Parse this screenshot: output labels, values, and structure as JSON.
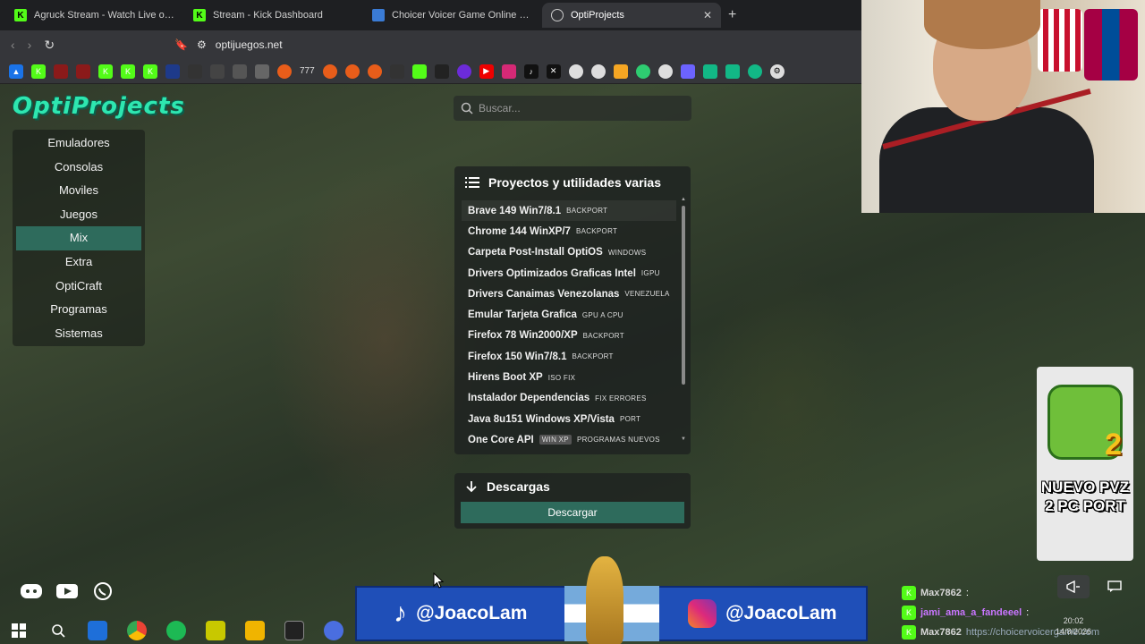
{
  "browser": {
    "tabs": [
      {
        "title": "Agruck Stream - Watch Live on K",
        "icon": "kick-logo",
        "active": false
      },
      {
        "title": "Stream - Kick Dashboard",
        "icon": "kick-logo",
        "active": false
      },
      {
        "title": "Choicer Voicer Game Online Free - R",
        "icon": "game-favicon",
        "active": false
      },
      {
        "title": "OptiProjects",
        "icon": "site-favicon",
        "active": true
      }
    ],
    "url": "optijuegos.net",
    "bookmark_text": "777"
  },
  "site": {
    "logo": "OptiProjects",
    "search_placeholder": "Buscar...",
    "sidebar": [
      {
        "label": "Emuladores",
        "active": false
      },
      {
        "label": "Consolas",
        "active": false
      },
      {
        "label": "Moviles",
        "active": false
      },
      {
        "label": "Juegos",
        "active": false
      },
      {
        "label": "Mix",
        "active": true
      },
      {
        "label": "Extra",
        "active": false
      },
      {
        "label": "OptiCraft",
        "active": false
      },
      {
        "label": "Programas",
        "active": false
      },
      {
        "label": "Sistemas",
        "active": false
      }
    ],
    "projects_panel": {
      "title": "Proyectos y utilidades varias",
      "items": [
        {
          "name": "Brave 149 Win7/8.1",
          "tag": "BACKPORT"
        },
        {
          "name": "Chrome 144 WinXP/7",
          "tag": "BACKPORT"
        },
        {
          "name": "Carpeta Post-Install OptiOS",
          "tag": "WINDOWS"
        },
        {
          "name": "Drivers Optimizados Graficas Intel",
          "tag": "IGPU"
        },
        {
          "name": "Drivers Canaimas Venezolanas",
          "tag": "VENEZUELA"
        },
        {
          "name": "Emular Tarjeta Grafica",
          "tag": "GPU A CPU"
        },
        {
          "name": "Firefox 78 Win2000/XP",
          "tag": "BACKPORT"
        },
        {
          "name": "Firefox 150 Win7/8.1",
          "tag": "BACKPORT"
        },
        {
          "name": "Hirens Boot XP",
          "tag": "ISO FIX"
        },
        {
          "name": "Instalador Dependencias",
          "tag": "FIX ERRORES"
        },
        {
          "name": "Java 8u151 Windows XP/Vista",
          "tag": "PORT"
        },
        {
          "name": "One Core API",
          "tag_box": "WIN XP",
          "tag": "PROGRAMAS NUEVOS"
        }
      ]
    },
    "downloads_panel": {
      "title": "Descargas",
      "button": "Descargar"
    }
  },
  "overlay": {
    "pvz_card": "NUEVO PVZ 2 PC PORT",
    "banner_left": "@JoacoLam",
    "banner_right": "@JoacoLam",
    "chat": [
      {
        "user": "Max7862",
        "message": ":"
      },
      {
        "user": "jami_ama_a_fandeeel",
        "message": ":"
      },
      {
        "user": "Max7862",
        "message": "https://choicervoicergame.com"
      }
    ],
    "clock_time": "20:02",
    "clock_date": "14/8/2026"
  },
  "colors": {
    "accent": "#2e6b5c",
    "logo": "#2ee6b0",
    "banner": "#1f4fb8",
    "kick": "#53fc18"
  }
}
